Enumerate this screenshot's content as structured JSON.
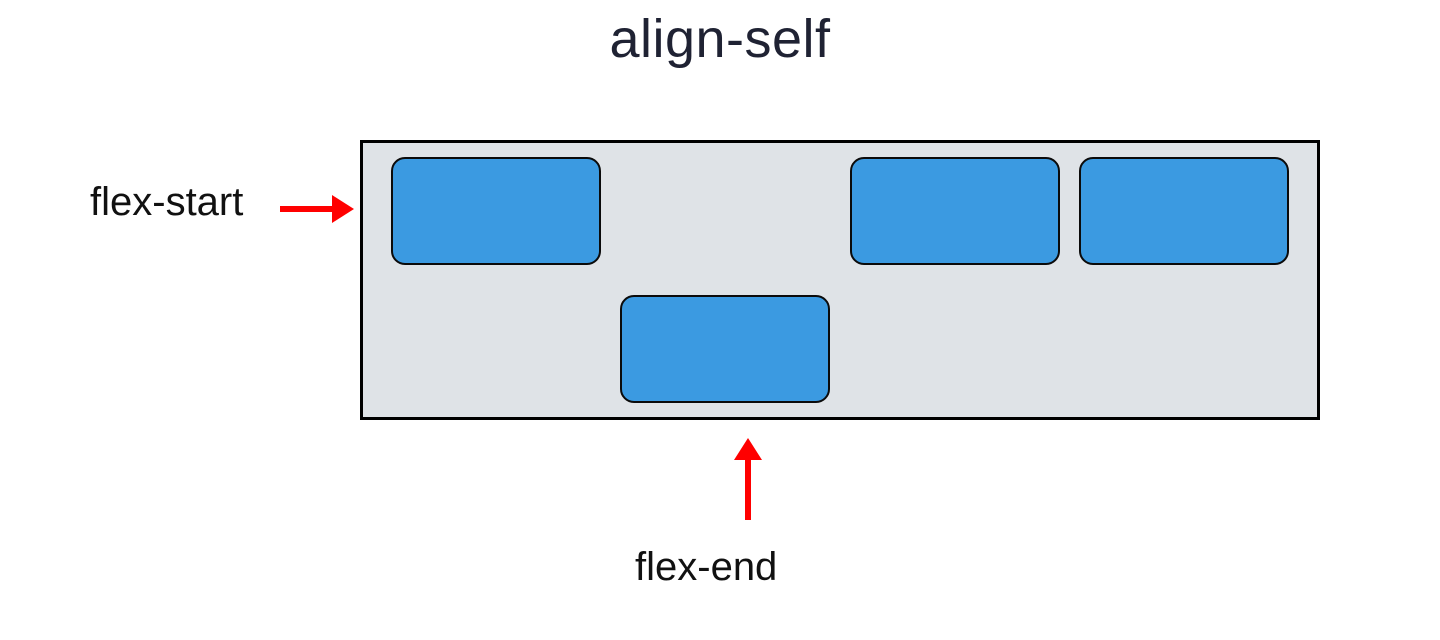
{
  "title": "align-self",
  "labels": {
    "flex_start": "flex-start",
    "flex_end": "flex-end"
  },
  "colors": {
    "title_text": "#1f2233",
    "item_fill": "#3b9ae1",
    "item_border": "#0b0b0b",
    "container_fill": "#dfe3e7",
    "container_border": "#000000",
    "arrow": "#ff0000",
    "label_text": "#111111",
    "page_bg": "#ffffff"
  },
  "diagram": {
    "css_property": "align-self",
    "container_align_items": "flex-start",
    "items": [
      {
        "index": 1,
        "align_self": "flex-start"
      },
      {
        "index": 2,
        "align_self": "flex-end"
      },
      {
        "index": 3,
        "align_self": "flex-start"
      },
      {
        "index": 4,
        "align_self": "flex-start"
      }
    ],
    "annotations": [
      {
        "value": "flex-start",
        "points_to_item_index": 1,
        "arrow_direction": "right"
      },
      {
        "value": "flex-end",
        "points_to_item_index": 2,
        "arrow_direction": "up"
      }
    ]
  }
}
